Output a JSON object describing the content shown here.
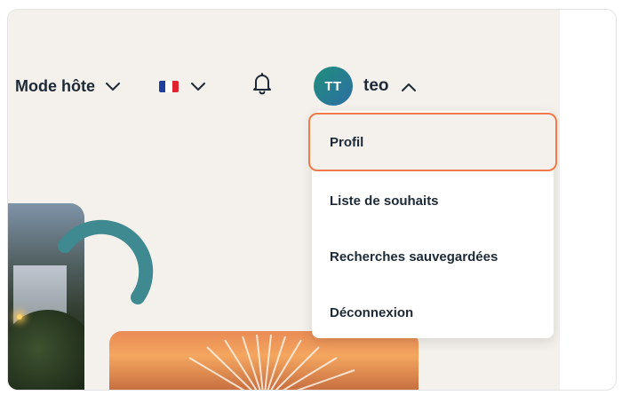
{
  "header": {
    "host_mode_label": "Mode hôte",
    "language_flag": "fr-flag-icon",
    "notifications_icon": "bell-icon",
    "user": {
      "initials": "TT",
      "name": "teo"
    }
  },
  "user_menu": {
    "items": [
      {
        "label": "Profil",
        "highlighted": true
      },
      {
        "label": "Liste de souhaits"
      },
      {
        "label": "Recherches sauvegardées"
      },
      {
        "label": "Déconnexion"
      }
    ]
  },
  "colors": {
    "background": "#f4f1ec",
    "text": "#1d2a36",
    "highlight_border": "#f07a4a",
    "accent_arc": "#3f8a90",
    "avatar_gradient": [
      "#1f8e7c",
      "#2d6fa3"
    ]
  }
}
